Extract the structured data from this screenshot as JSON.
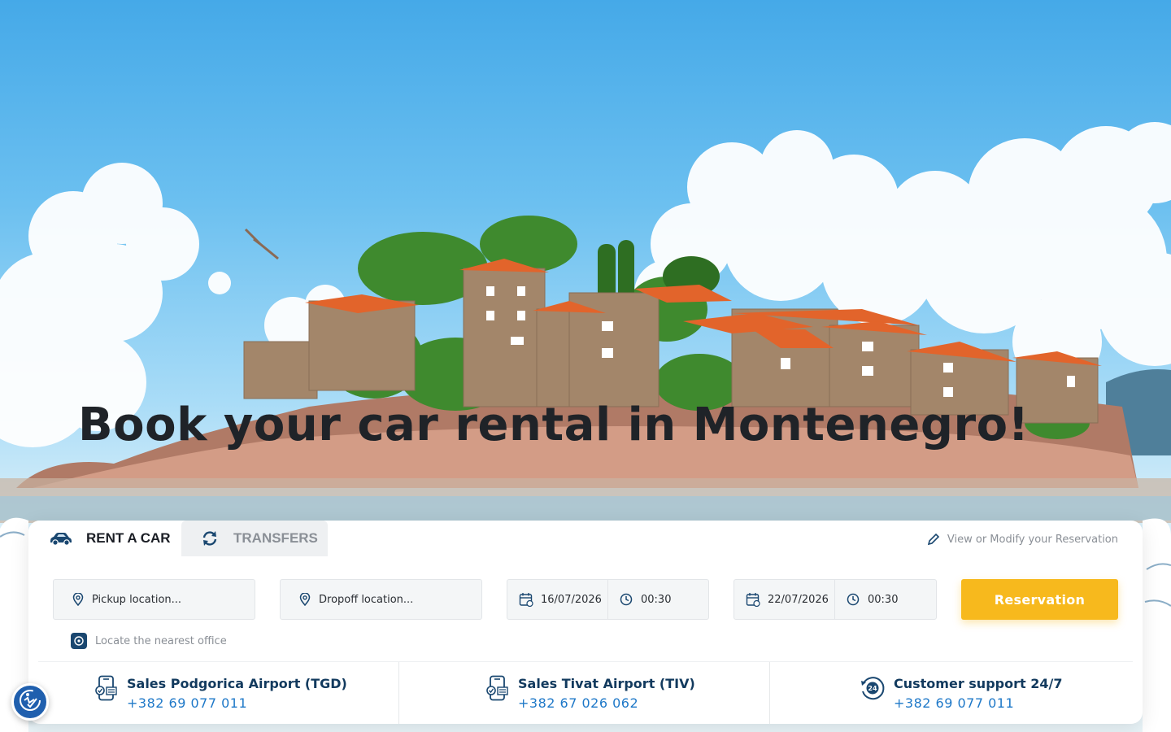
{
  "hero": {
    "headline": "Book your car rental in Montenegro!",
    "image_icon": "sveti-stefan-island-photo"
  },
  "tabs": [
    {
      "label": "RENT A CAR",
      "icon": "car-icon",
      "active": true
    },
    {
      "label": "TRANSFERS",
      "icon": "refresh-icon",
      "active": false
    }
  ],
  "modify": {
    "label": "View or Modify your Reservation",
    "icon": "pencil-icon"
  },
  "search": {
    "pickup": {
      "placeholder": "Pickup location...",
      "icon": "map-pin-icon"
    },
    "dropoff": {
      "placeholder": "Dropoff location...",
      "icon": "map-pin-icon"
    },
    "pickup_date": "16/07/2026",
    "pickup_time": "00:30",
    "dropoff_date": "22/07/2026",
    "dropoff_time": "00:30",
    "reserve_label": "Reservation",
    "locate_label": "Locate the nearest office"
  },
  "contacts": [
    {
      "title": "Sales Podgorica Airport (TGD)",
      "phone": "+382 69 077 011",
      "icon": "phone-sales-icon"
    },
    {
      "title": "Sales Tivat Airport (TIV)",
      "phone": "+382 67 026 062",
      "icon": "phone-sales-icon"
    },
    {
      "title": "Customer support 24/7",
      "phone": "+382 69 077 011",
      "icon": "support-24-icon"
    }
  ],
  "colors": {
    "accent": "#f7b91d",
    "brand_dark": "#123a5e",
    "link": "#1e78c8",
    "a11y_button": "#1f5fae"
  },
  "a11y": {
    "icon": "accessibility-icon"
  }
}
